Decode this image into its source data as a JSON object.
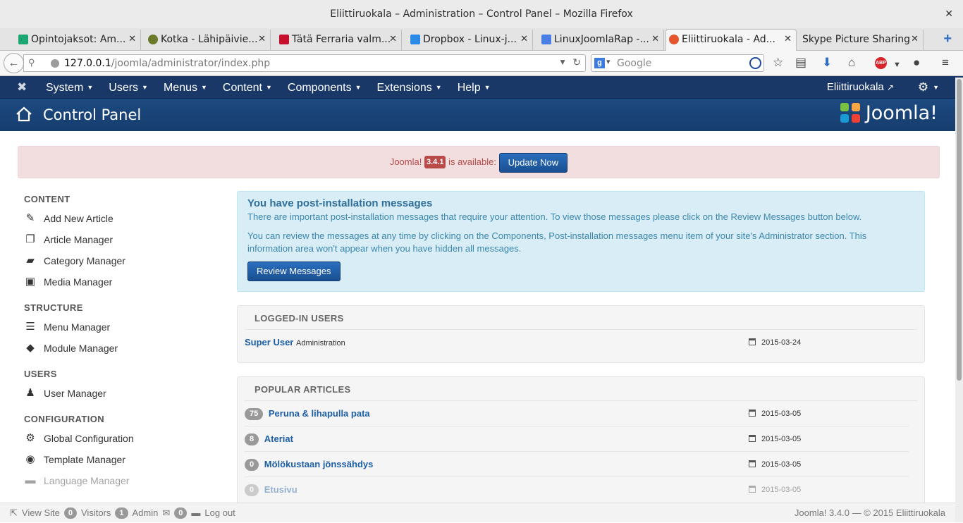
{
  "window": {
    "title": "Eliittiruokala – Administration – Control Panel – Mozilla Firefox",
    "close": "✕"
  },
  "tabs": [
    {
      "label": "Opintojaksot: Am...",
      "fav_color": "#1ea672"
    },
    {
      "label": "Kotka - Lähipäivie...",
      "fav_color": "#6b7a2a"
    },
    {
      "label": "Tätä Ferraria valm...",
      "fav_color": "#c8102e"
    },
    {
      "label": "Dropbox - Linux-j...",
      "fav_color": "#2b8ae8"
    },
    {
      "label": "LinuxJoomlaRap -...",
      "fav_color": "#4a7ee6"
    },
    {
      "label": "Eliittiruokala - Ad...",
      "fav_color": "#e5552c"
    },
    {
      "label": "Skype Picture Sharing",
      "fav_color": ""
    }
  ],
  "tab_close": "✕",
  "newtab": "+",
  "address": {
    "host": "127.0.0.1",
    "path": "/joomla/administrator/index.php"
  },
  "search": {
    "placeholder": "Google",
    "engine_letter": "g"
  },
  "joomla_nav": {
    "menu": [
      "System",
      "Users",
      "Menus",
      "Content",
      "Components",
      "Extensions",
      "Help"
    ],
    "site_name": "Eliittiruokala",
    "caret": "▼"
  },
  "header": {
    "title": "Control Panel",
    "brand": "Joomla!"
  },
  "update_alert": {
    "prefix": "Joomla!",
    "version": "3.4.1",
    "suffix": "is available:",
    "button": "Update Now"
  },
  "sidebar": {
    "content_heading": "CONTENT",
    "content_items": [
      "Add New Article",
      "Article Manager",
      "Category Manager",
      "Media Manager"
    ],
    "structure_heading": "STRUCTURE",
    "structure_items": [
      "Menu Manager",
      "Module Manager"
    ],
    "users_heading": "USERS",
    "users_items": [
      "User Manager"
    ],
    "configuration_heading": "CONFIGURATION",
    "configuration_items": [
      "Global Configuration",
      "Template Manager",
      "Language Manager"
    ]
  },
  "postinstall": {
    "title": "You have post-installation messages",
    "p1": "There are important post-installation messages that require your attention. To view those messages please click on the Review Messages button below.",
    "p2": "You can review the messages at any time by clicking on the Components, Post-installation messages menu item of your site's Administrator section. This information area won't appear when you have hidden all messages.",
    "button": "Review Messages"
  },
  "logged_in": {
    "heading": "LOGGED-IN USERS",
    "rows": [
      {
        "name": "Super User",
        "area": "Administration",
        "date": "2015-03-24"
      }
    ]
  },
  "popular": {
    "heading": "POPULAR ARTICLES",
    "rows": [
      {
        "hits": "75",
        "title": "Peruna & lihapulla pata",
        "date": "2015-03-05"
      },
      {
        "hits": "8",
        "title": "Ateriat",
        "date": "2015-03-05"
      },
      {
        "hits": "0",
        "title": "Mölökustaan jönssähdys",
        "date": "2015-03-05"
      },
      {
        "hits": "0",
        "title": "Etusivu",
        "date": "2015-03-05"
      }
    ]
  },
  "footer": {
    "view_site": "View Site",
    "visitors_count": "0",
    "visitors_label": "Visitors",
    "admin_count": "1",
    "admin_label": "Admin",
    "messages_count": "0",
    "logout": "Log out",
    "copyright": "Joomla! 3.4.0 — © 2015 Eliittiruokala"
  }
}
